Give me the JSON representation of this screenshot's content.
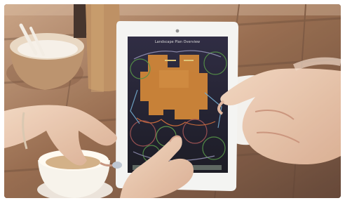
{
  "scene": {
    "subject": "hands-holding-tablet",
    "tablet_screen": {
      "title": "Landscape Plan Overview",
      "accent": "#d8862f",
      "screen_dark": "#181628"
    },
    "colors": {
      "table_light": "#b48b69",
      "table_dark": "#6b4a35",
      "skin": "#e5c3a8",
      "tablet_white": "#f4f4f2",
      "cup": "#f7f3ea",
      "bowl": "#b98f68"
    }
  }
}
